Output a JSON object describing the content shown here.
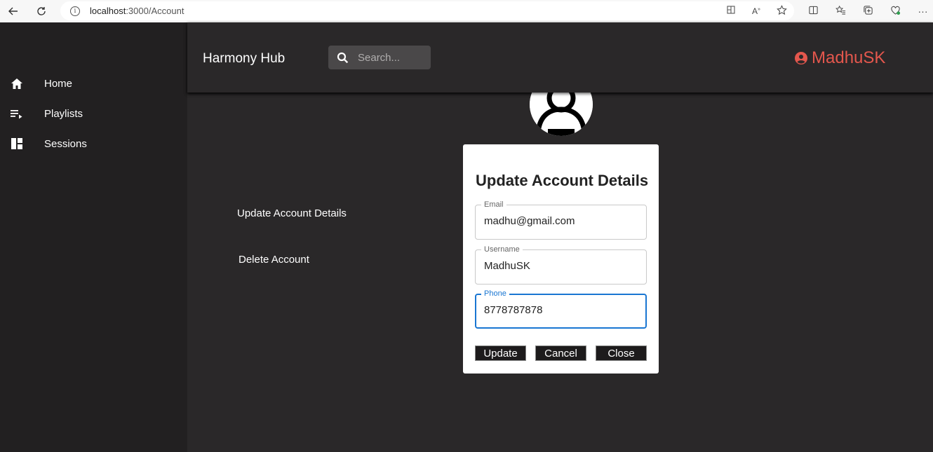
{
  "browser": {
    "url_host": "localhost",
    "url_path": ":3000/Account",
    "back_icon": "back-arrow-icon",
    "refresh_icon": "refresh-icon"
  },
  "sidebar": {
    "items": [
      {
        "label": "Home",
        "icon": "home-icon"
      },
      {
        "label": "Playlists",
        "icon": "playlist-icon"
      },
      {
        "label": "Sessions",
        "icon": "dashboard-icon"
      }
    ]
  },
  "header": {
    "brand": "Harmony Hub",
    "search_placeholder": "Search...",
    "username": "MadhuSK",
    "accent_color": "#e4574d"
  },
  "account_menu": {
    "update_label": "Update Account Details",
    "delete_label": "Delete Account"
  },
  "dialog": {
    "title": "Update Account Details",
    "fields": [
      {
        "label": "Email",
        "value": "madhu@gmail.com"
      },
      {
        "label": "Username",
        "value": "MadhuSK"
      },
      {
        "label": "Phone",
        "value": "8778787878"
      }
    ],
    "buttons": {
      "update": "Update",
      "cancel": "Cancel",
      "close": "Close"
    },
    "focus_color": "#1976d2"
  }
}
